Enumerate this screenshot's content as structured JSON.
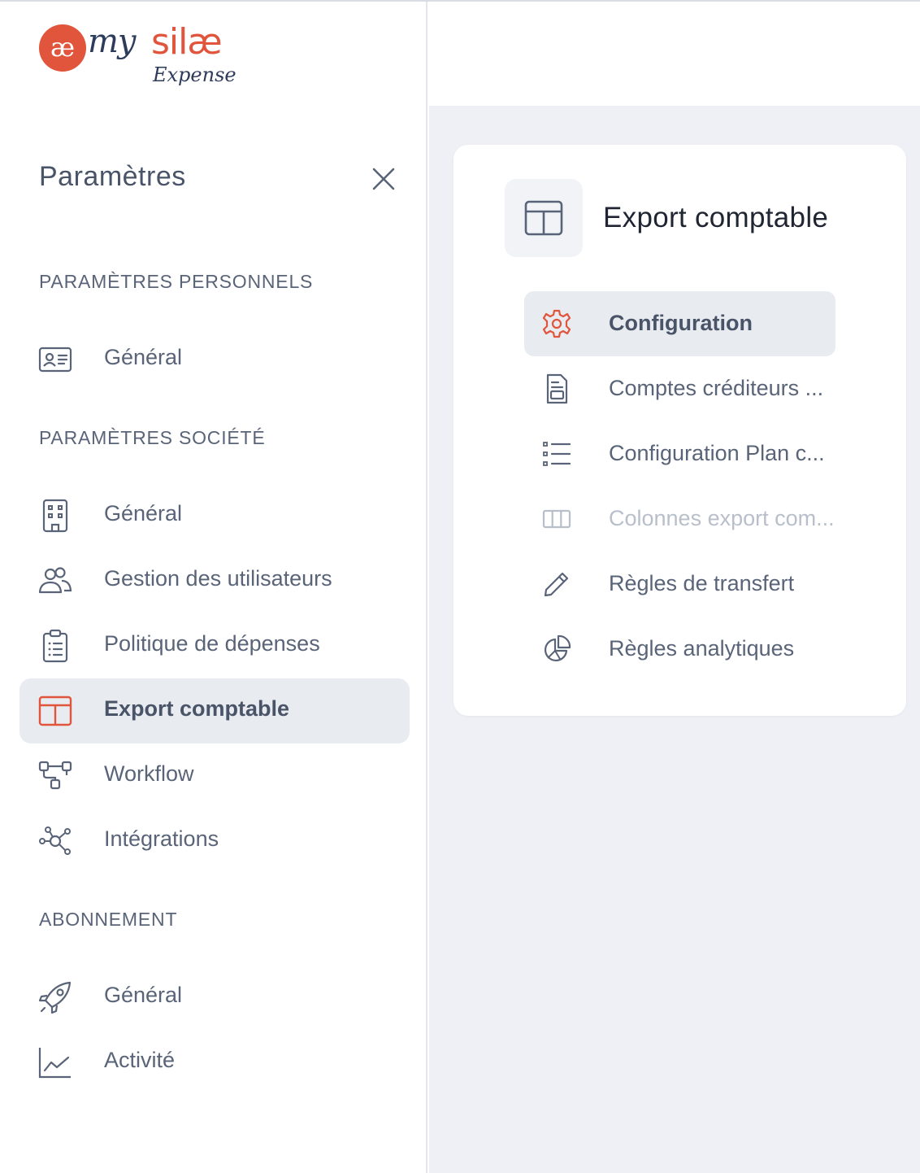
{
  "colors": {
    "accent": "#e0553b",
    "text": "#5a6478",
    "active_bg": "#e8ebf0",
    "main_bg": "#eef0f6",
    "disabled_text": "#b8bfcb"
  },
  "logo": {
    "mark": "æ",
    "my": "my",
    "brand": "silæ",
    "product": "Expense"
  },
  "sidebar": {
    "title": "Paramètres",
    "close_icon": "close-icon",
    "sections": [
      {
        "label": "PARAMÈTRES PERSONNELS",
        "items": [
          {
            "label": "Général",
            "icon": "id-card-icon"
          }
        ]
      },
      {
        "label": "PARAMÈTRES SOCIÉTÉ",
        "items": [
          {
            "label": "Général",
            "icon": "building-icon"
          },
          {
            "label": "Gestion des utilisateurs",
            "icon": "users-icon"
          },
          {
            "label": "Politique de dépenses",
            "icon": "clipboard-list-icon"
          },
          {
            "label": "Export comptable",
            "icon": "layout-icon",
            "active": true
          },
          {
            "label": "Workflow",
            "icon": "workflow-icon"
          },
          {
            "label": "Intégrations",
            "icon": "network-icon"
          }
        ]
      },
      {
        "label": "ABONNEMENT",
        "items": [
          {
            "label": "Général",
            "icon": "rocket-icon"
          },
          {
            "label": "Activité",
            "icon": "chart-line-icon"
          }
        ]
      }
    ]
  },
  "card": {
    "title": "Export comptable",
    "icon": "layout-icon",
    "items": [
      {
        "label": "Configuration",
        "icon": "gear-icon",
        "active": true
      },
      {
        "label": "Comptes créditeurs ...",
        "icon": "document-icon"
      },
      {
        "label": "Configuration Plan c...",
        "icon": "list-icon"
      },
      {
        "label": "Colonnes export com...",
        "icon": "columns-icon",
        "disabled": true
      },
      {
        "label": "Règles de transfert",
        "icon": "pencil-icon"
      },
      {
        "label": "Règles analytiques",
        "icon": "pie-chart-icon"
      }
    ]
  }
}
